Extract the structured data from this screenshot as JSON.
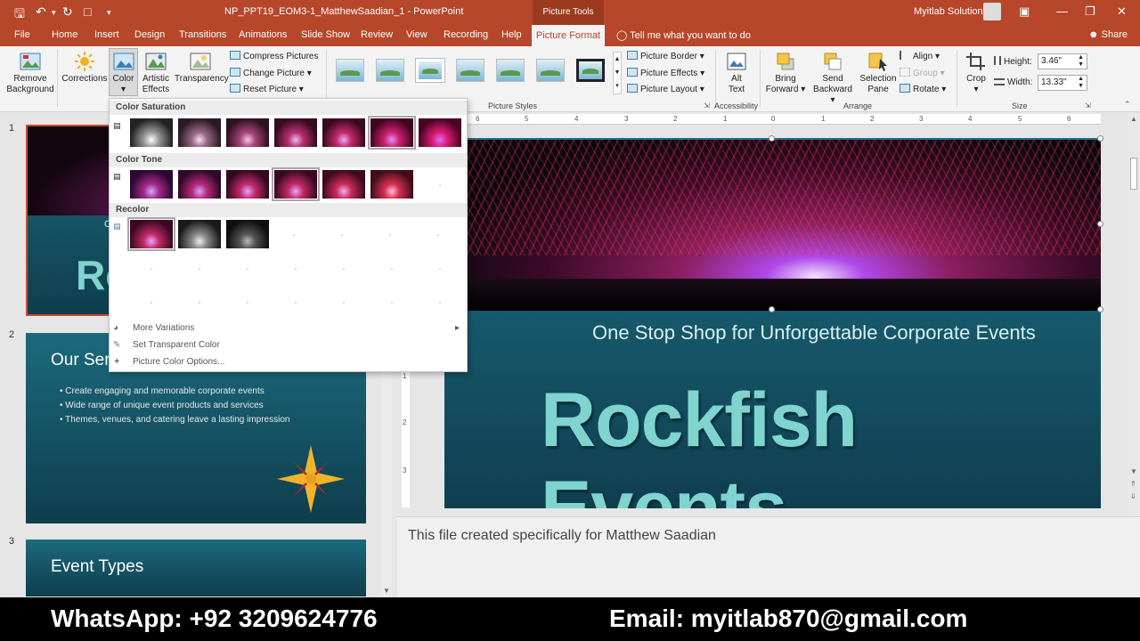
{
  "app": {
    "doc_title": "NP_PPT19_EOM3-1_MatthewSaadian_1  -  PowerPoint",
    "tools_context": "Picture Tools",
    "account": "Myitlab Solution"
  },
  "tabs": [
    "File",
    "Home",
    "Insert",
    "Design",
    "Transitions",
    "Animations",
    "Slide Show",
    "Review",
    "View",
    "Recording",
    "Help"
  ],
  "active_tab": "Picture Format",
  "tellme": "Tell me what you want to do",
  "share": "Share",
  "ribbon": {
    "remove_bg": [
      "Remove",
      "Background"
    ],
    "corrections": "Corrections",
    "color": "Color",
    "artistic": [
      "Artistic",
      "Effects"
    ],
    "transparency": "Transparency",
    "compress": "Compress Pictures",
    "change": "Change Picture",
    "reset": "Reset Picture",
    "picture_styles_label": "Picture Styles",
    "border": "Picture Border",
    "effects": "Picture Effects",
    "layout": "Picture Layout",
    "alt_text": [
      "Alt",
      "Text"
    ],
    "accessibility_label": "Accessibility",
    "bring_forward": [
      "Bring",
      "Forward"
    ],
    "send_backward": [
      "Send",
      "Backward"
    ],
    "selection_pane": [
      "Selection",
      "Pane"
    ],
    "align": "Align",
    "group": "Group",
    "rotate": "Rotate",
    "arrange_label": "Arrange",
    "crop": "Crop",
    "height_label": "Height:",
    "height_value": "3.46\"",
    "width_label": "Width:",
    "width_value": "13.33\"",
    "size_label": "Size"
  },
  "color_dropdown": {
    "saturation_header": "Color Saturation",
    "tone_header": "Color Tone",
    "recolor_header": "Recolor",
    "more_variations": "More Variations",
    "set_transparent": "Set Transparent Color",
    "color_options": "Picture Color Options..."
  },
  "slides": {
    "numbers": [
      "1",
      "2",
      "3"
    ],
    "slide1_partial": [
      "O",
      "Ro"
    ],
    "slide2_title": "Our Ser",
    "slide2_bullets": [
      "Create engaging and memorable corporate events",
      "Wide range of unique event products and services",
      "Themes, venues, and catering leave a lasting impression"
    ],
    "slide3_title": "Event Types"
  },
  "main_slide": {
    "subtitle": "One Stop Shop for Unforgettable Corporate Events",
    "title": "Rockfish Events"
  },
  "ruler_numbers": [
    "6",
    "5",
    "4",
    "3",
    "2",
    "1",
    "0",
    "1",
    "2",
    "3",
    "4",
    "5",
    "6"
  ],
  "ruler_v_numbers": [
    "1",
    "2",
    "3"
  ],
  "notes": "This file created specifically for Matthew Saadian",
  "banner": {
    "whatsapp": "WhatsApp: +92 3209624776",
    "email": "Email: myitlab870@gmail.com"
  },
  "colors": {
    "accent": "#b7472a",
    "slide_bg": "#1d7185",
    "title_teal": "#7fd4d0"
  }
}
